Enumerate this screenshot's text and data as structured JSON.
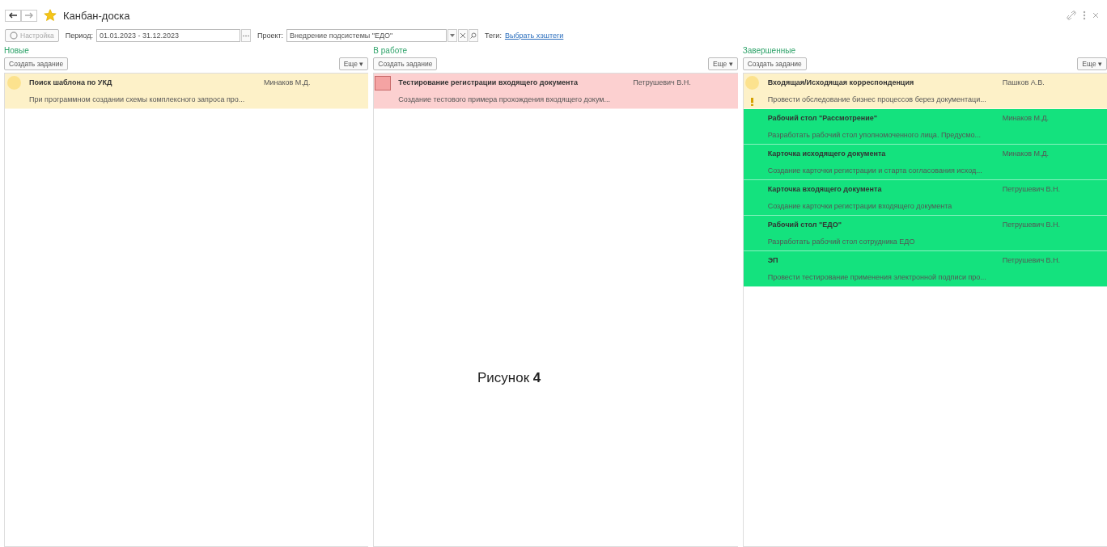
{
  "window": {
    "title": "Канбан-доска",
    "favorite": true
  },
  "filters": {
    "settings_button": "Настройка",
    "period_label": "Период:",
    "period_value": "01.01.2023 - 31.12.2023",
    "project_label": "Проект:",
    "project_value": "Внедрение подсистемы \"ЕДО\"",
    "tags_label": "Теги:",
    "tags_link": "Выбрать хэштеги"
  },
  "columns": [
    {
      "title": "Новые",
      "create_button": "Создать задание",
      "more_button": "Еще ▾",
      "cards": [
        {
          "kind": "circle",
          "title": "Поиск шаблона по УКД",
          "assignee": "Минаков М.Д.",
          "description": "При программном создании схемы комплексного запроса про...",
          "color": "#fdf1c8",
          "important": false
        }
      ]
    },
    {
      "title": "В работе",
      "create_button": "Создать задание",
      "more_button": "Еще ▾",
      "cards": [
        {
          "kind": "square",
          "title": "Тестирование регистрации входящего документа",
          "assignee": "Петрушевич В.Н.",
          "description": "Создание тестового примера прохождения входящего докум...",
          "color": "#fcd0d0",
          "important": false
        }
      ]
    },
    {
      "title": "Завершенные",
      "create_button": "Создать задание",
      "more_button": "Еще ▾",
      "cards": [
        {
          "kind": "circle",
          "title": "Входящая/Исходящая корреспонденция",
          "assignee": "Пашков А.В.",
          "description": "Провести обследование бизнес процессов берез документаци...",
          "color": "#fdf1c8",
          "important": true
        },
        {
          "kind": "plain",
          "title": "Рабочий стол \"Рассмотрение\"",
          "assignee": "Минаков М.Д.",
          "description": "Разработать рабочий стол уполномоченного лица. Предусмо...",
          "color": "#14e27e",
          "important": false
        },
        {
          "kind": "plain",
          "title": "Карточка исходящего документа",
          "assignee": "Минаков М.Д.",
          "description": "Создание карточки регистрации и старта согласования исход...",
          "color": "#14e27e",
          "important": false
        },
        {
          "kind": "plain",
          "title": "Карточка входящего документа",
          "assignee": "Петрушевич В.Н.",
          "description": "Создание карточки регистрации входящего документа",
          "color": "#14e27e",
          "important": false
        },
        {
          "kind": "plain",
          "title": "Рабочий стол \"ЕДО\"",
          "assignee": "Петрушевич В.Н.",
          "description": "Разработать рабочий стол сотрудника ЕДО",
          "color": "#14e27e",
          "important": false
        },
        {
          "kind": "plain",
          "title": "ЭП",
          "assignee": "Петрушевич В.Н.",
          "description": "Провести тестирование применения электронной подписи про...",
          "color": "#14e27e",
          "important": false
        }
      ]
    }
  ],
  "caption": "Рисунок **4**"
}
